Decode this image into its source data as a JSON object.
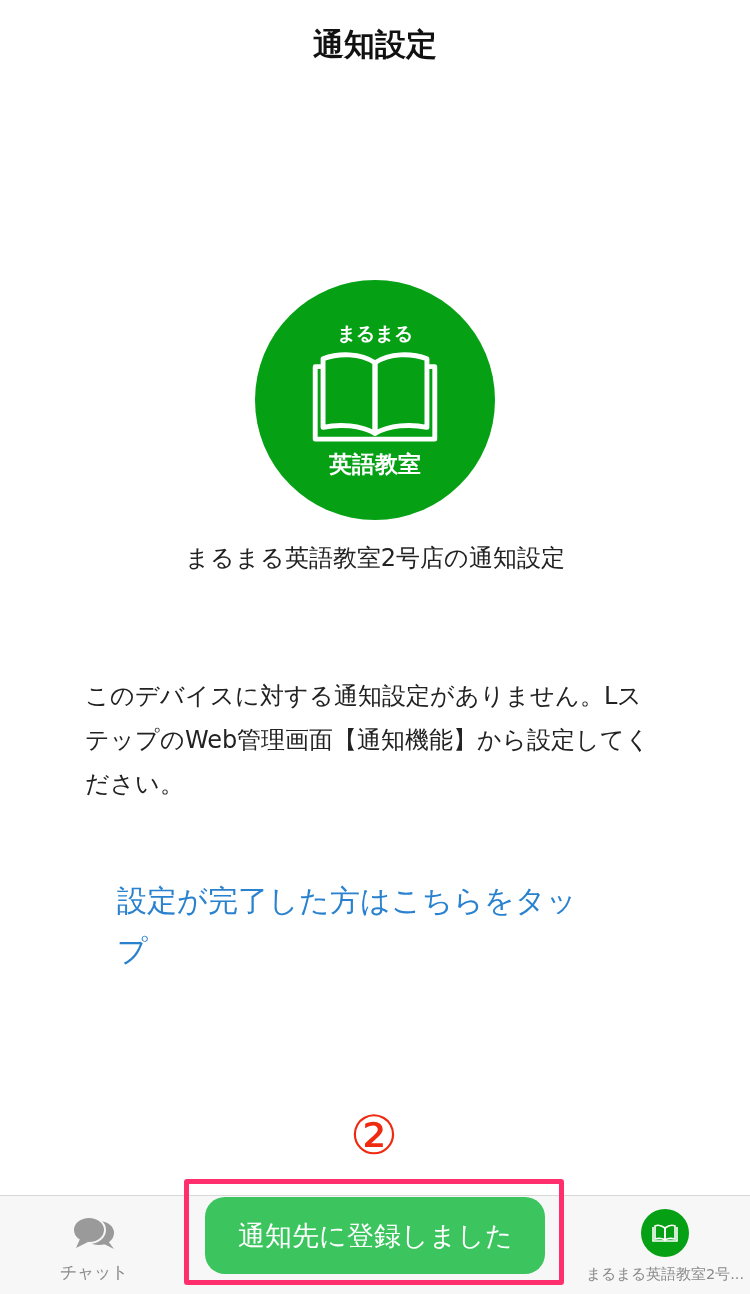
{
  "header": {
    "title": "通知設定"
  },
  "logo": {
    "top_text": "まるまる",
    "bottom_text": "英語教室"
  },
  "account_caption": "まるまる英語教室2号店の通知設定",
  "message": "このデバイスに対する通知設定がありません。LステップのWeb管理画面【通知機能】から設定してください。",
  "link": "設定が完了した方はこちらをタップ",
  "annotation": {
    "number": "②"
  },
  "toast": {
    "text": "通知先に登録しました"
  },
  "tab_bar": [
    {
      "kind": "chat",
      "label": "チャット",
      "selected": false
    },
    {
      "kind": "account",
      "label": "まるまる英語教室2号...",
      "selected": false
    }
  ]
}
